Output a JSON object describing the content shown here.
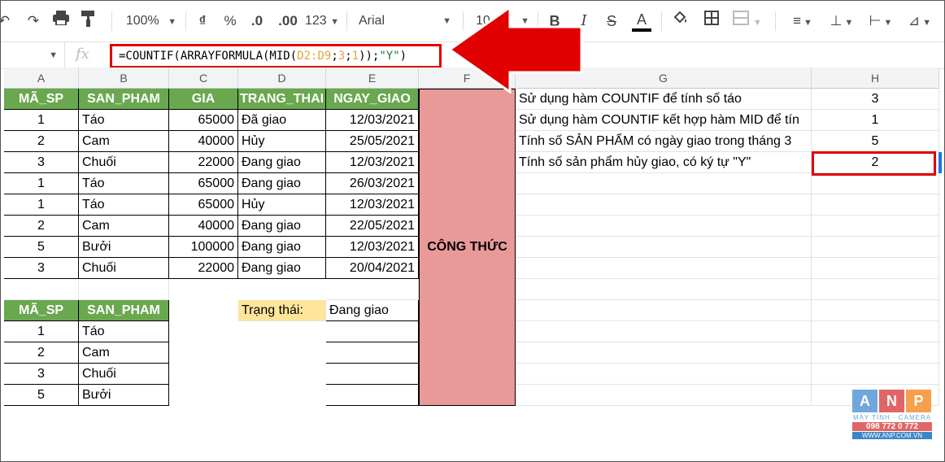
{
  "toolbar": {
    "zoom": "100%",
    "currency": "₫",
    "percent": "%",
    "dec_decrease": ".0",
    "dec_increase": ".00",
    "more_formats": "123",
    "font": "Arial",
    "font_size": "10",
    "bold": "B",
    "text_color": "A"
  },
  "formula_bar": {
    "fx": "fx",
    "formula_parts": [
      "=COUNTIF(ARRAYFORMULA(MID(",
      "D2:D9",
      ";",
      "3",
      ";",
      "1",
      "));",
      "\"Y\"",
      ")"
    ]
  },
  "columns": [
    "A",
    "B",
    "C",
    "D",
    "E",
    "F",
    "G",
    "H"
  ],
  "table1": {
    "headers": [
      "MÃ_SP",
      "SAN_PHAM",
      "GIA",
      "TRANG_THAI",
      "NGAY_GIAO"
    ],
    "rows": [
      [
        "1",
        "Táo",
        "65000",
        "Đã giao",
        "12/03/2021"
      ],
      [
        "2",
        "Cam",
        "40000",
        "Hủy",
        "25/05/2021"
      ],
      [
        "3",
        "Chuối",
        "22000",
        "Đang giao",
        "12/03/2021"
      ],
      [
        "1",
        "Táo",
        "65000",
        "Đang giao",
        "26/03/2021"
      ],
      [
        "1",
        "Táo",
        "65000",
        "Hủy",
        "12/03/2021"
      ],
      [
        "2",
        "Cam",
        "40000",
        "Đang giao",
        "22/05/2021"
      ],
      [
        "5",
        "Bưởi",
        "100000",
        "Đang giao",
        "12/03/2021"
      ],
      [
        "3",
        "Chuối",
        "22000",
        "Đang giao",
        "20/04/2021"
      ]
    ]
  },
  "table2": {
    "headers": [
      "MÃ_SP",
      "SAN_PHAM"
    ],
    "rows": [
      [
        "1",
        "Táo"
      ],
      [
        "2",
        "Cam"
      ],
      [
        "3",
        "Chuối"
      ],
      [
        "5",
        "Bưởi"
      ]
    ]
  },
  "status_filter": {
    "label": "Trạng thái:",
    "value": "Đang giao"
  },
  "formula_label": "CÔNG THỨC",
  "questions": [
    {
      "text": "Sử dụng hàm COUNTIF để tính số táo",
      "result": "3"
    },
    {
      "text": "Sử dụng hàm COUNTIF kết hợp hàm MID để tín",
      "result": "1"
    },
    {
      "text": "Tính số SẢN PHẨM có ngày giao trong tháng 3",
      "result": "5"
    },
    {
      "text": "Tính số sản phẩm hủy giao, có ký tự \"Y\"",
      "result": "2"
    }
  ],
  "logo": {
    "letters": [
      "A",
      "N",
      "P"
    ],
    "tagline": "MÁY TÍNH · CAMERA",
    "phone": "098 772 0 772",
    "website": "WWW.ANP.COM.VN"
  },
  "colors": {
    "header_green": "#6aa84f",
    "formula_pink": "#ea9999",
    "highlight_red": "#e00000",
    "status_yellow": "#ffe599"
  }
}
